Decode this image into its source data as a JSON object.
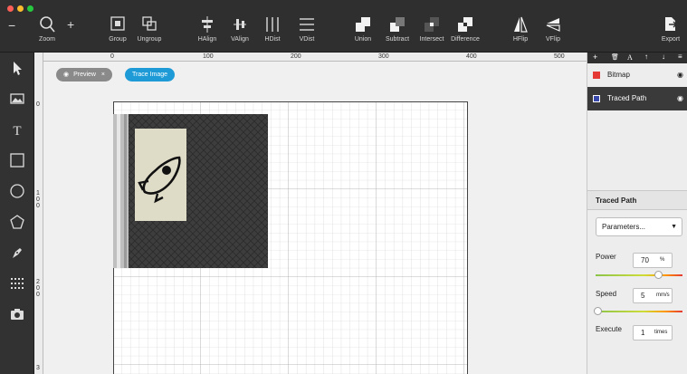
{
  "toolbar": {
    "zoom_out": "−",
    "zoom_in": "+",
    "zoom_label": "Zoom",
    "buttons": [
      {
        "label": "Group",
        "icon": "group-icon"
      },
      {
        "label": "Ungroup",
        "icon": "ungroup-icon"
      },
      {
        "label": "HAlign",
        "icon": "halign-icon"
      },
      {
        "label": "VAlign",
        "icon": "valign-icon"
      },
      {
        "label": "HDist",
        "icon": "hdist-icon"
      },
      {
        "label": "VDist",
        "icon": "vdist-icon"
      },
      {
        "label": "Union",
        "icon": "union-icon"
      },
      {
        "label": "Subtract",
        "icon": "subtract-icon"
      },
      {
        "label": "Intersect",
        "icon": "intersect-icon"
      },
      {
        "label": "Difference",
        "icon": "difference-icon"
      },
      {
        "label": "HFlip",
        "icon": "hflip-icon"
      },
      {
        "label": "VFlip",
        "icon": "vflip-icon"
      }
    ],
    "export_label": "Export"
  },
  "ruler": {
    "top": [
      "0",
      "100",
      "200",
      "300",
      "400",
      "500"
    ],
    "left": [
      "0",
      "100",
      "200",
      "3"
    ]
  },
  "canvas": {
    "preview_label": "Preview",
    "preview_close": "×",
    "trace_label": "Trace Image"
  },
  "layers": {
    "header_icons": [
      "+",
      "🗑",
      "A",
      "↑",
      "↓",
      "≡"
    ],
    "items": [
      {
        "name": "Bitmap",
        "color": "#e53935",
        "selected": false
      },
      {
        "name": "Traced Path",
        "color": "#3949ab",
        "selected": true
      }
    ]
  },
  "properties": {
    "title": "Traced Path",
    "dropdown": "Parameters...",
    "power_label": "Power",
    "power_value": "70",
    "power_unit": "%",
    "speed_label": "Speed",
    "speed_value": "5",
    "speed_unit": "mm/s",
    "execute_label": "Execute",
    "execute_value": "1",
    "execute_unit": "times"
  },
  "colors": {
    "accent": "#1e9bd7",
    "toolbar": "#2f2f2f",
    "selected_layer": "#3a3a3a"
  }
}
